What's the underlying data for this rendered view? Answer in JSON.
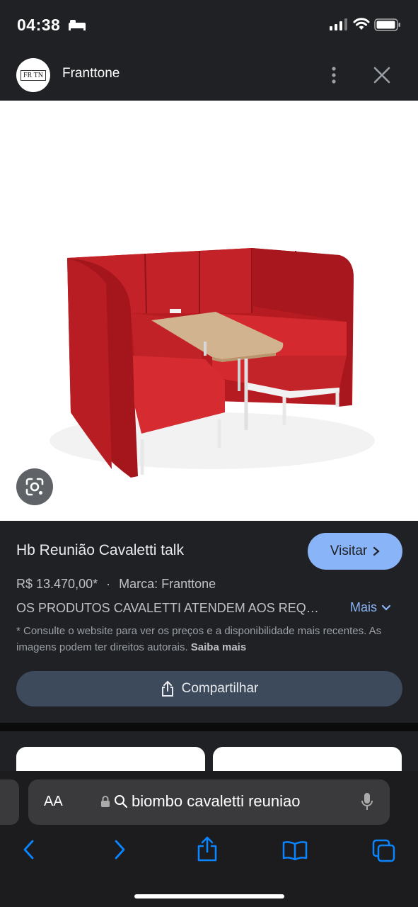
{
  "status_bar": {
    "time": "04:38"
  },
  "header": {
    "logo_text": "FR TN",
    "site_name": "Franttone"
  },
  "product": {
    "title": "Hb Reunião Cavaletti talk",
    "visit_label": "Visitar",
    "price": "R$ 13.470,00*",
    "separator": "·",
    "brand": "Marca: Franttone",
    "description": "OS PRODUTOS CAVALETTI ATENDEM AOS REQUISITOS",
    "more_label": "Mais",
    "disclaimer": "* Consulte o website para ver os preços e a disponibilidade mais recentes. As imagens podem ter direitos autorais.",
    "learn_more": "Saiba mais",
    "share_label": "Compartilhar"
  },
  "safari": {
    "text_size_label": "AA",
    "url": "biombo cavaletti reuniao"
  },
  "colors": {
    "accent": "#8ab4f8",
    "sofa_red": "#c41f24",
    "bg": "#202124"
  }
}
